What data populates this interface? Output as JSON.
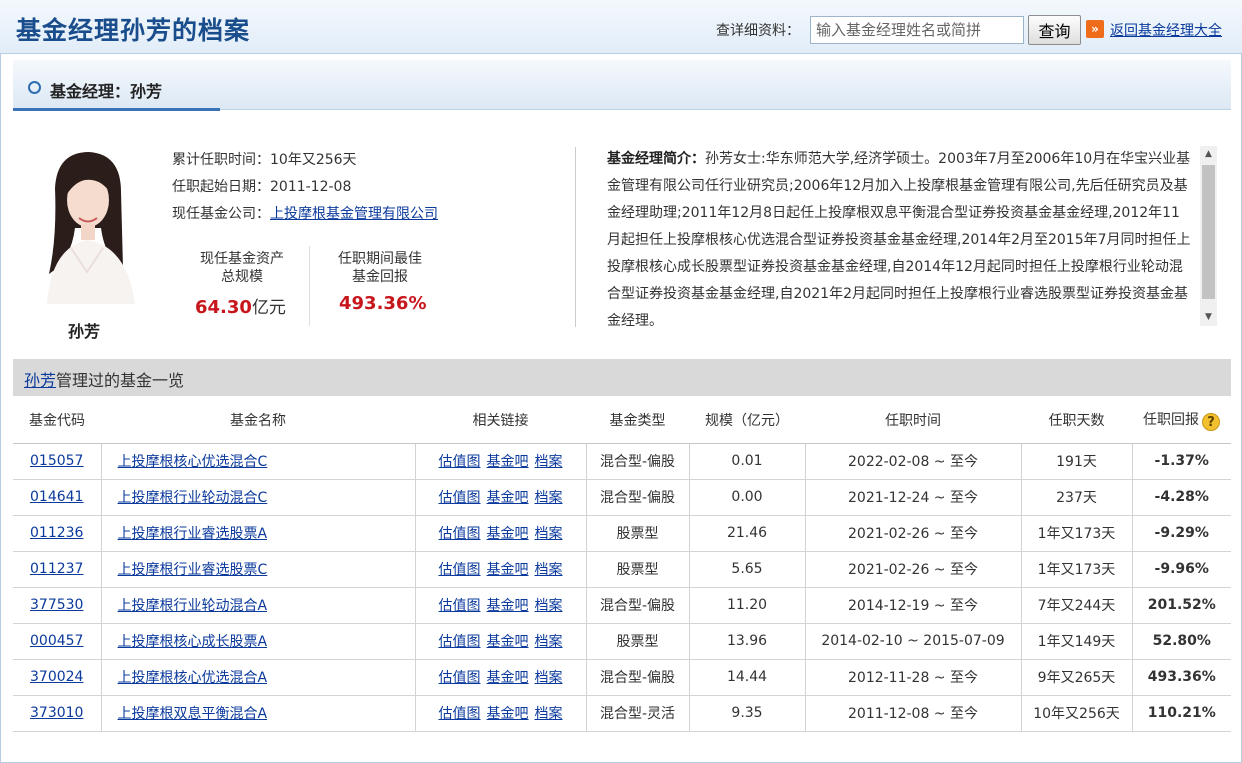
{
  "header": {
    "title": "基金经理孙芳的档案",
    "search_label": "查详细资料：",
    "search_placeholder": "输入基金经理姓名或简拼",
    "search_button": "查询",
    "back_link": "返回基金经理大全"
  },
  "manager": {
    "section_title": "基金经理：孙芳",
    "name": "孙芳",
    "tenure_label": "累计任职时间：",
    "tenure": "10年又256天",
    "start_label": "任职起始日期：",
    "start_date": "2011-12-08",
    "company_label": "现任基金公司：",
    "company": "上投摩根基金管理有限公司",
    "assets_label_1": "现任基金资产",
    "assets_label_2": "总规模",
    "assets_value": "64.30",
    "assets_unit": "亿元",
    "best_label_1": "任职期间最佳",
    "best_label_2": "基金回报",
    "best_value": "493.36%",
    "bio_label": "基金经理简介：",
    "bio_text": "孙芳女士:华东师范大学,经济学硕士。2003年7月至2006年10月在华宝兴业基金管理有限公司任行业研究员;2006年12月加入上投摩根基金管理有限公司,先后任研究员及基金经理助理;2011年12月8日起任上投摩根双息平衡混合型证券投资基金基金经理,2012年11月起担任上投摩根核心优选混合型证券投资基金基金经理,2014年2月至2015年7月同时担任上投摩根核心成长股票型证券投资基金基金经理,自2014年12月起同时担任上投摩根行业轮动混合型证券投资基金基金经理,自2021年2月起同时担任上投摩根行业睿选股票型证券投资基金基金经理。"
  },
  "fund_list": {
    "title_link": "孙芳",
    "title_rest": "管理过的基金一览",
    "headers": [
      "基金代码",
      "基金名称",
      "相关链接",
      "基金类型",
      "规模（亿元）",
      "任职时间",
      "任职天数",
      "任职回报"
    ],
    "link_labels": [
      "估值图",
      "基金吧",
      "档案"
    ],
    "rows": [
      {
        "code": "015057",
        "name": "上投摩根核心优选混合C",
        "type": "混合型-偏股",
        "size": "0.01",
        "period": "2022-02-08 ~ 至今",
        "days": "191天",
        "return": "-1.37%",
        "positive": false
      },
      {
        "code": "014641",
        "name": "上投摩根行业轮动混合C",
        "type": "混合型-偏股",
        "size": "0.00",
        "period": "2021-12-24 ~ 至今",
        "days": "237天",
        "return": "-4.28%",
        "positive": false
      },
      {
        "code": "011236",
        "name": "上投摩根行业睿选股票A",
        "type": "股票型",
        "size": "21.46",
        "period": "2021-02-26 ~ 至今",
        "days": "1年又173天",
        "return": "-9.29%",
        "positive": false
      },
      {
        "code": "011237",
        "name": "上投摩根行业睿选股票C",
        "type": "股票型",
        "size": "5.65",
        "period": "2021-02-26 ~ 至今",
        "days": "1年又173天",
        "return": "-9.96%",
        "positive": false
      },
      {
        "code": "377530",
        "name": "上投摩根行业轮动混合A",
        "type": "混合型-偏股",
        "size": "11.20",
        "period": "2014-12-19 ~ 至今",
        "days": "7年又244天",
        "return": "201.52%",
        "positive": true
      },
      {
        "code": "000457",
        "name": "上投摩根核心成长股票A",
        "type": "股票型",
        "size": "13.96",
        "period": "2014-02-10 ~ 2015-07-09",
        "days": "1年又149天",
        "return": "52.80%",
        "positive": true
      },
      {
        "code": "370024",
        "name": "上投摩根核心优选混合A",
        "type": "混合型-偏股",
        "size": "14.44",
        "period": "2012-11-28 ~ 至今",
        "days": "9年又265天",
        "return": "493.36%",
        "positive": true
      },
      {
        "code": "373010",
        "name": "上投摩根双息平衡混合A",
        "type": "混合型-灵活",
        "size": "9.35",
        "period": "2011-12-08 ~ 至今",
        "days": "10年又256天",
        "return": "110.21%",
        "positive": true
      }
    ]
  }
}
